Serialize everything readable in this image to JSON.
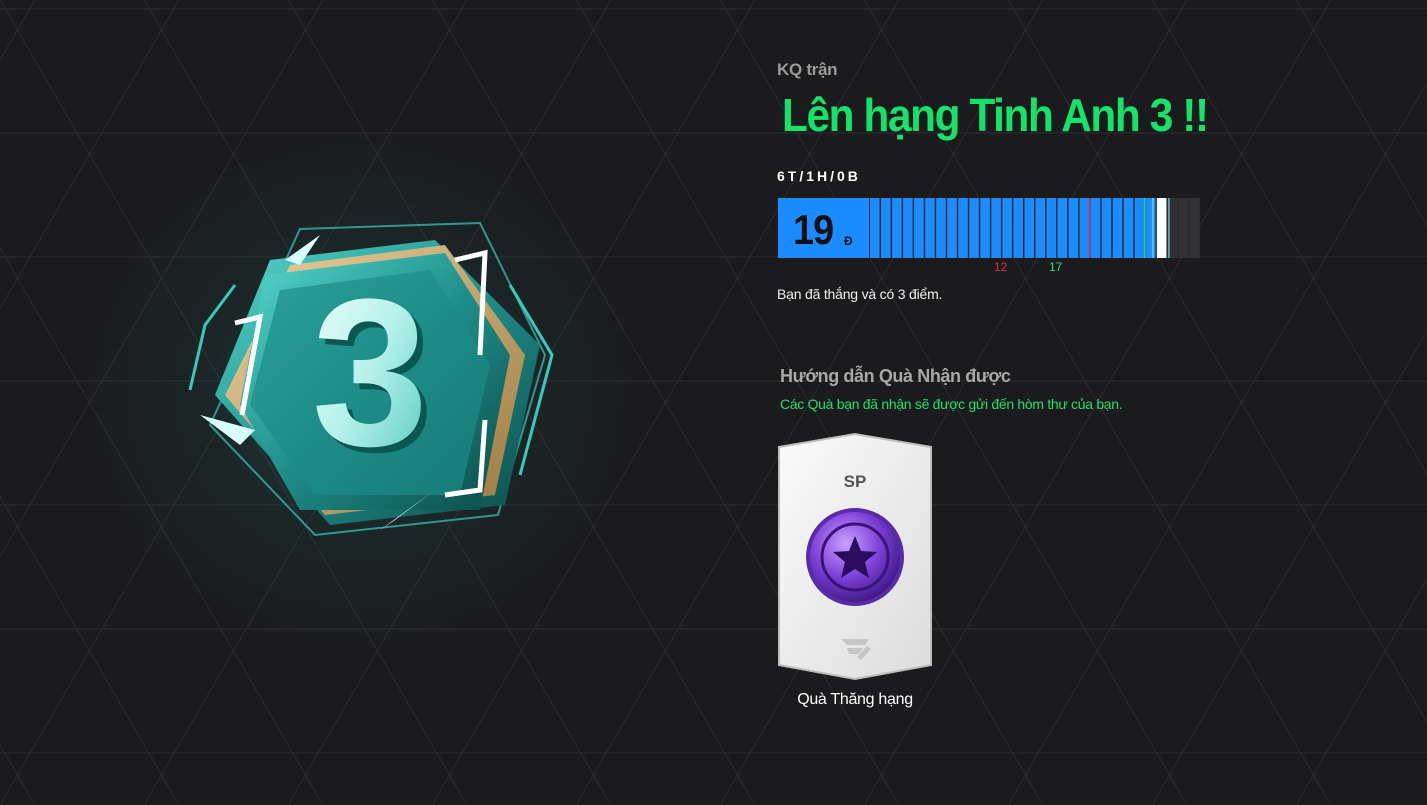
{
  "result": {
    "label": "KQ trận",
    "title": "Lên hạng Tinh Anh 3  !!",
    "record": "6T/1H/0B",
    "points": 19,
    "points_unit": "Đ",
    "bar": {
      "max_points": 30,
      "filled_points": 27,
      "markers": [
        {
          "label": "12",
          "value": 20,
          "color": "#e03232"
        },
        {
          "label": "17",
          "value": 25,
          "color": "#1fe070"
        }
      ]
    },
    "message": "Bạn đã thắng và có 3 điểm."
  },
  "emblem": {
    "rank_number": "3"
  },
  "rewards": {
    "heading": "Hướng dẫn Quà Nhận được",
    "note": "Các Quà bạn đã nhận sẽ được gửi đến hòm thư của bạn.",
    "items": [
      {
        "type": "SP",
        "icon": "purple-star-coin-icon",
        "caption": "Quà Thăng hạng"
      }
    ]
  },
  "colors": {
    "accent_green": "#14e36a",
    "bar_blue": "#1a8cff",
    "teal": "#2ec4b6"
  }
}
